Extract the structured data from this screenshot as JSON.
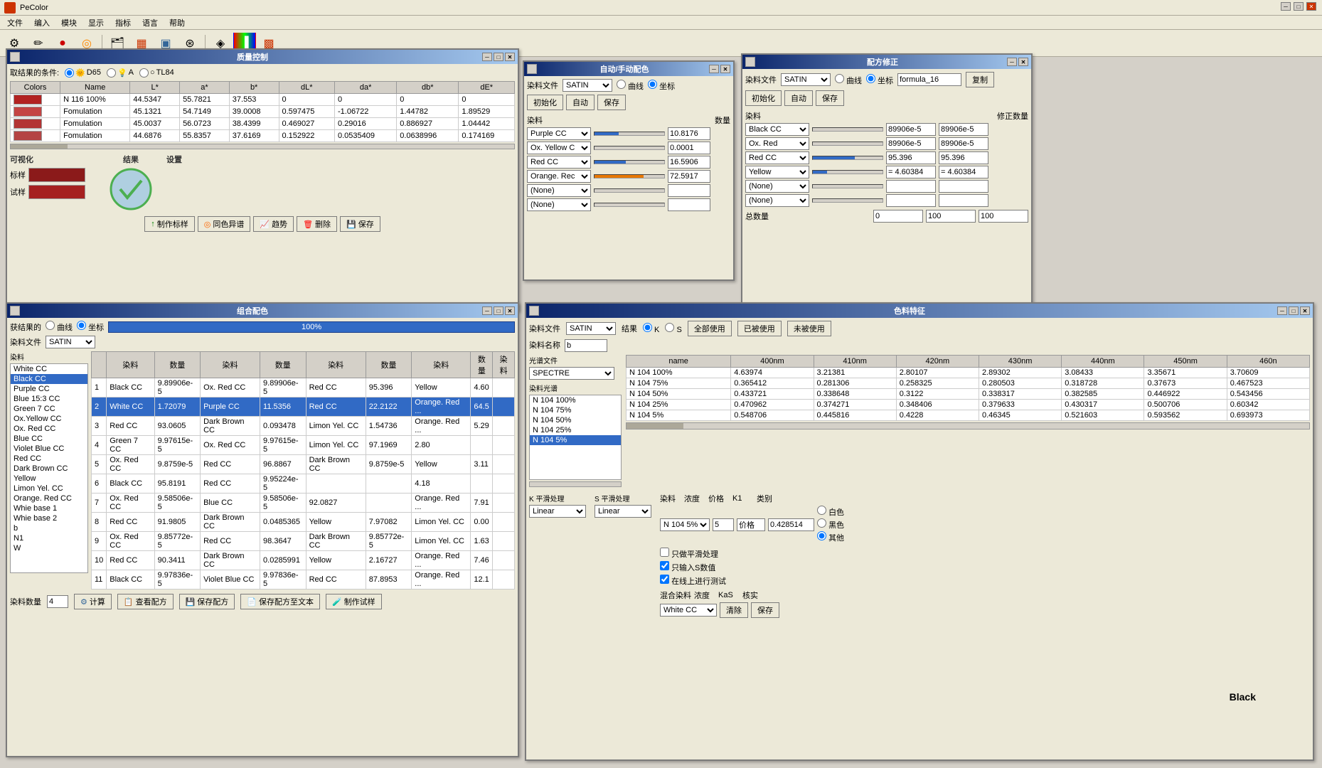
{
  "app": {
    "title": "PeColor",
    "menu": [
      "文件",
      "编入",
      "模块",
      "显示",
      "指标",
      "语言",
      "帮助"
    ]
  },
  "window_quality": {
    "title": "质量控制",
    "condition_label": "取结果的条件:",
    "illuminants": [
      "D65",
      "A",
      "TL84"
    ],
    "table_headers": [
      "Colors",
      "Name",
      "L*",
      "a*",
      "b*",
      "dL*",
      "da*",
      "db*",
      "dE*"
    ],
    "rows": [
      {
        "color": "#b22222",
        "name": "N 116 100%",
        "L": "44.5347",
        "a": "55.7821",
        "b": "37.553",
        "dL": "0",
        "da": "0",
        "db": "0",
        "dE": "0"
      },
      {
        "color": "#c44444",
        "name": "Fomulation",
        "L": "45.1321",
        "a": "54.7149",
        "b": "39.0008",
        "dL": "0.597475",
        "da": "-1.06722",
        "db": "1.44782",
        "dE": "1.89529"
      },
      {
        "color": "#b33333",
        "name": "Fomulation",
        "L": "45.0037",
        "a": "56.0723",
        "b": "38.4399",
        "dL": "0.469027",
        "da": "0.29016",
        "db": "0.886927",
        "dE": "1.04442"
      },
      {
        "color": "#b44444",
        "name": "Fomulation",
        "L": "44.6876",
        "a": "55.8357",
        "b": "37.6169",
        "dL": "0.152922",
        "da": "0.0535409",
        "db": "0.0638996",
        "dE": "0.174169"
      }
    ],
    "visible_label": "可视化",
    "result_label": "结果",
    "settings_label": "设置",
    "standard_label": "标样",
    "sample_label": "试样",
    "buttons": [
      "制作标样",
      "同色异谱",
      "趋势",
      "删除",
      "保存"
    ]
  },
  "window_auto_manual": {
    "title": "自动/手动配色",
    "dye_file_label": "染料文件",
    "dye_file_value": "SATIN",
    "view_options": [
      "曲线",
      "坐标"
    ],
    "selected_view": "坐标",
    "buttons": [
      "初始化",
      "自动",
      "保存"
    ],
    "dye_label": "染料",
    "amount_label": "数量",
    "dyes": [
      {
        "name": "Purple CC",
        "amount": "10.8176",
        "slider_pct": 35
      },
      {
        "name": "Ox. Yellow C",
        "amount": "0.0001",
        "slider_pct": 0
      },
      {
        "name": "Red CC",
        "amount": "16.5906",
        "slider_pct": 45
      },
      {
        "name": "Orange. Rec",
        "amount": "72.5917",
        "slider_pct": 70
      },
      {
        "name": "(None)",
        "amount": "",
        "slider_pct": 0
      },
      {
        "name": "(None)",
        "amount": "",
        "slider_pct": 0
      }
    ]
  },
  "window_formula_correction": {
    "title": "配方修正",
    "dye_file_label": "染料文件",
    "dye_file_value": "SATIN",
    "formula_name": "formula_16",
    "view_options": [
      "曲线",
      "坐标"
    ],
    "selected_view": "坐标",
    "copy_label": "复制",
    "buttons": [
      "初始化",
      "自动",
      "保存"
    ],
    "dye_label": "染料",
    "correction_amount_label": "修正数量",
    "dyes": [
      {
        "name": "Black CC",
        "amount1": "89906e-5",
        "amount2": "89906e-5"
      },
      {
        "name": "Ox. Red",
        "amount1": "89906e-5",
        "amount2": "89906e-5"
      },
      {
        "name": "Red CC",
        "amount1": "95.396",
        "amount2": "95.396"
      },
      {
        "name": "Yellow",
        "amount1": "= 4.60384",
        "amount2": "= 4.60384"
      },
      {
        "name": "(None)",
        "amount1": "",
        "amount2": ""
      },
      {
        "name": "(None)",
        "amount1": "",
        "amount2": ""
      }
    ],
    "total_label": "总数量",
    "total_values": [
      "0",
      "100",
      "100"
    ]
  },
  "window_combo_color": {
    "title": "组合配色",
    "fetch_label": "获结果的",
    "view_options": [
      "曲线",
      "坐标"
    ],
    "selected_view": "坐标",
    "dye_file_label": "染料文件",
    "dye_file_value": "SATIN",
    "dye_label": "染料",
    "progress_pct": "100%",
    "col_headers": [
      "",
      "染料",
      "数量",
      "染料",
      "数量",
      "染料",
      "数量",
      "染料",
      "数量",
      "染料"
    ],
    "rows": [
      {
        "n": "1",
        "d1": "Black CC",
        "q1": "9.89906e-5",
        "d2": "Ox. Red CC",
        "q2": "9.89906e-5",
        "d3": "Red CC",
        "q3": "95.396",
        "d4": "Yellow",
        "q4": "4.60"
      },
      {
        "n": "2",
        "d1": "White CC",
        "q1": "1.72079",
        "d2": "Purple CC",
        "q2": "11.5356",
        "d3": "Red CC",
        "q3": "22.2122",
        "d4": "Orange. Red ...",
        "q4": "64.5"
      },
      {
        "n": "3",
        "d1": "Red CC",
        "q1": "93.0605",
        "d2": "Dark Brown CC",
        "q2": "0.093478",
        "d3": "Limon Yel. CC",
        "q3": "1.54736",
        "d4": "Orange. Red ...",
        "q4": "5.29"
      },
      {
        "n": "4",
        "d1": "Green 7 CC",
        "q1": "9.97615e-5",
        "d2": "Ox. Red CC",
        "q2": "9.97615e-5",
        "d3": "Limon Yel. CC",
        "q3": "97.1969",
        "d4": "2.80"
      },
      {
        "n": "5",
        "d1": "Ox. Red CC",
        "q1": "9.8759e-5",
        "d2": "Red CC",
        "q2": "96.8867",
        "d3": "Dark Brown CC",
        "q3": "9.8759e-5",
        "d4": "Yellow",
        "q4": "3.11"
      },
      {
        "n": "6",
        "d1": "Black CC",
        "q1": "95.8191",
        "d2": "Red CC",
        "q2": "9.95224e-5",
        "d3": "",
        "q3": "",
        "d4": "4.18"
      },
      {
        "n": "7",
        "d1": "Ox. Red CC",
        "q1": "9.58506e-5",
        "d2": "Blue CC",
        "q2": "9.58506e-5",
        "d3": "92.0827",
        "d4": "Orange. Red ...",
        "q4": "7.91"
      },
      {
        "n": "8",
        "d1": "Red CC",
        "q1": "91.9805",
        "d2": "Dark Brown CC",
        "q2": "0.0485365",
        "d3": "Yellow",
        "q3": "7.97082",
        "d4": "Limon Yel. CC",
        "q4": "0.00"
      },
      {
        "n": "9",
        "d1": "Ox. Red CC",
        "q1": "9.85772e-5",
        "d2": "Red CC",
        "q2": "98.3647",
        "d3": "Dark Brown CC",
        "q3": "9.85772e-5",
        "d4": "Limon Yel. CC",
        "q4": "1.63"
      },
      {
        "n": "10",
        "d1": "Red CC",
        "q1": "90.3411",
        "d2": "Dark Brown CC",
        "q2": "0.0285991",
        "d3": "Yellow",
        "q3": "2.16727",
        "d4": "Orange. Red ...",
        "q4": "7.46"
      },
      {
        "n": "11",
        "d1": "Black CC",
        "q1": "9.97836e-5",
        "d2": "Violet Blue CC",
        "q2": "9.97836e-5",
        "d3": "Red CC",
        "q3": "87.8953",
        "d4": "Orange. Red ...",
        "q4": "12.1"
      }
    ],
    "left_list": [
      "White CC",
      "Black CC",
      "Purple CC",
      "Blue 15:3 CC",
      "Green 7 CC",
      "Ox.Yellow CC",
      "Ox. Red CC",
      "Blue CC",
      "Violet Blue CC",
      "Red CC",
      "Dark Brown CC",
      "Yellow",
      "Limon Yel. CC",
      "Orange. Red CC",
      "Whie base 1",
      "Whie base 2",
      "b",
      "N1",
      "W"
    ],
    "selected_left": "Black CC",
    "dye_count_label": "染料数量",
    "dye_count": "4",
    "buttons": [
      "计算",
      "查看配方",
      "保存配方",
      "保存配方至文本",
      "制作试样"
    ]
  },
  "window_dye_properties": {
    "title": "色料特征",
    "dye_file_label": "染料文件",
    "dye_file_value": "SATIN",
    "result_label": "结果",
    "view_options": [
      "K",
      "S"
    ],
    "selected_view": "K",
    "buttons_top": [
      "全部使用",
      "已被使用",
      "未被使用"
    ],
    "dye_name_label": "染料名称",
    "dye_name_value": "b",
    "light_file_label": "光谱文件",
    "light_file_value": "SPECTRE",
    "dye_spectra_label": "染料光谱",
    "dye_list": [
      "N 104 100%",
      "N 104 75%",
      "N 104 50%",
      "N 104 25%",
      "N 104 5%"
    ],
    "selected_dye": "N 104 5%",
    "table_headers": [
      "name",
      "400nm",
      "410nm",
      "420nm",
      "430nm",
      "440nm",
      "450nm",
      "460n"
    ],
    "spectra_rows": [
      {
        "name": "N 104 100%",
        "v400": "4.63974",
        "v410": "3.21381",
        "v420": "2.80107",
        "v430": "2.89302",
        "v440": "3.08433",
        "v450": "3.35671",
        "v460": "3.70609"
      },
      {
        "name": "N 104 75%",
        "v400": "0.365412",
        "v410": "0.281306",
        "v420": "0.258325",
        "v430": "0.280503",
        "v440": "0.318728",
        "v450": "0.37673",
        "v460": "0.467523"
      },
      {
        "name": "N 104 50%",
        "v400": "0.433721",
        "v410": "0.338648",
        "v420": "0.3122",
        "v430": "0.338317",
        "v440": "0.382585",
        "v450": "0.446922",
        "v460": "0.543456"
      },
      {
        "name": "N 104 25%",
        "v400": "0.470962",
        "v410": "0.374271",
        "v420": "0.348406",
        "v430": "0.379633",
        "v440": "0.430317",
        "v450": "0.500706",
        "v460": "0.60342"
      },
      {
        "name": "N 104 5%",
        "v400": "0.548706",
        "v410": "0.445816",
        "v420": "0.4228",
        "v430": "0.46345",
        "v440": "0.521603",
        "v450": "0.593562",
        "v460": "0.693973"
      }
    ],
    "smooth_label": "K 平滑处理",
    "smooth_value": "Linear",
    "smooth_s_label": "S 平滑处理",
    "smooth_s_value": "Linear",
    "dye_label": "染料",
    "conc_label": "浓度",
    "price_label": "价格",
    "k1_label": "K1",
    "type_label": "类别",
    "dye_bottom": "N 104 5▼",
    "conc_bottom": "5",
    "k1_value": "0.428514",
    "checkboxes": [
      "只做平滑处理",
      "只输入S数值",
      "在线上进行测试"
    ],
    "mix_conc_label": "浓度",
    "mix_label": "混合染料",
    "kas_label": "KaS",
    "verify_label": "核实",
    "dye_mix": "White CC▼",
    "clear_label": "清除",
    "save_label": "保存",
    "type_options": [
      "白色",
      "黑色",
      "其他"
    ],
    "selected_type": "其他",
    "black_label": "Black"
  }
}
